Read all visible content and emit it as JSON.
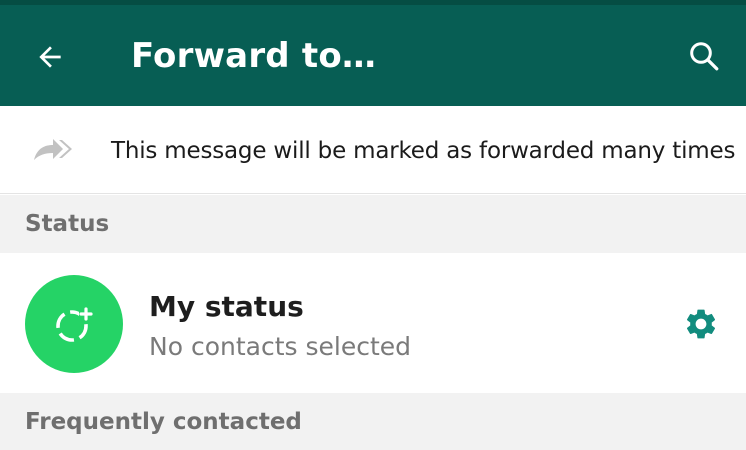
{
  "header": {
    "title": "Forward to…",
    "back_icon": "arrow-left-icon",
    "search_icon": "search-icon",
    "background_color": "#075e54"
  },
  "notice": {
    "icon": "forward-double-arrow-icon",
    "text": "This message will be marked as forwarded many times"
  },
  "sections": {
    "status_header": "Status",
    "frequent_header": "Frequently contacted"
  },
  "my_status": {
    "name": "My status",
    "subtitle": "No contacts selected",
    "avatar_icon": "add-status-icon",
    "settings_icon": "gear-icon",
    "avatar_color": "#25d366",
    "settings_color": "#128c7e"
  }
}
